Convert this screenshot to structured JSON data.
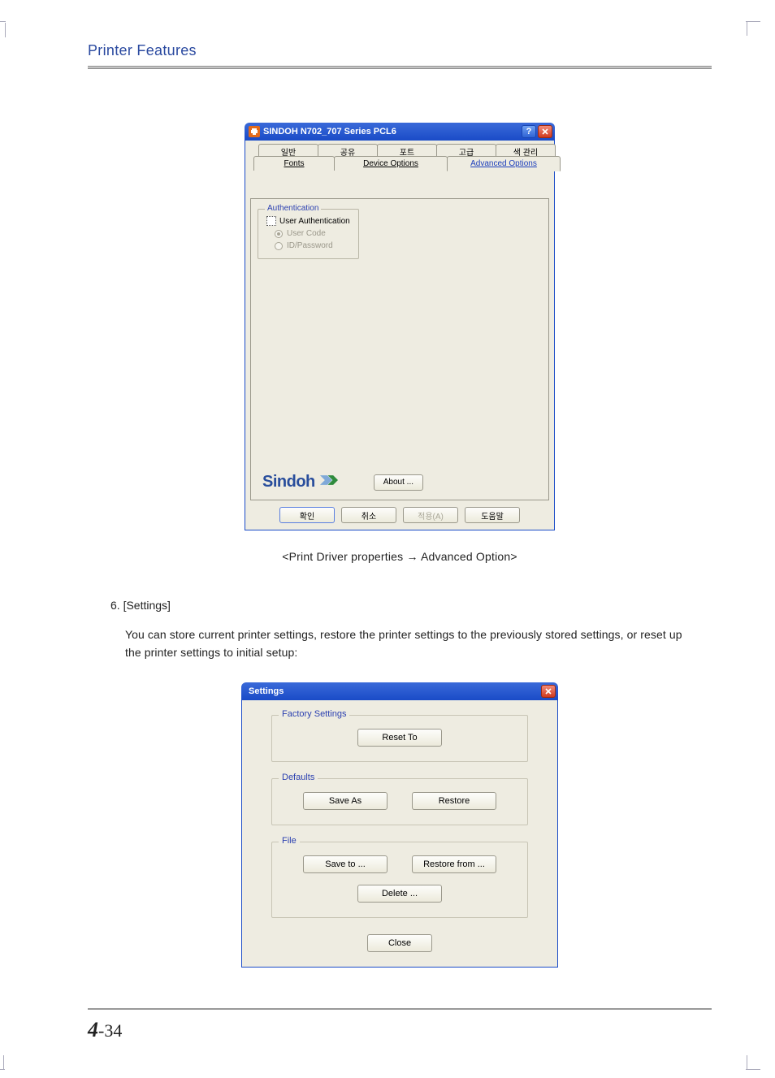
{
  "header_title": "Printer Features",
  "fig1": {
    "titlebar": "SINDOH N702_707 Series PCL6",
    "tabs_top": [
      "일반",
      "공유",
      "포트",
      "고급",
      "색 관리"
    ],
    "tabs_bot": [
      "Fonts",
      "Device Options",
      "Advanced Options"
    ],
    "auth": {
      "legend": "Authentication",
      "checkbox_label": "User Authentication",
      "radio_user_code": "User Code",
      "radio_id_password": "ID/Password"
    },
    "logo_text": "Sindoh",
    "about_btn": "About ...",
    "dlg_buttons": {
      "ok": "확인",
      "cancel": "취소",
      "apply": "적용(A)",
      "help": "도움말"
    }
  },
  "caption": "<Print Driver properties  → Advanced Option>",
  "step": {
    "heading": "6. [Settings]",
    "body": "You can store current printer settings, restore the printer settings to the previously stored settings, or reset up the printer settings to initial setup:"
  },
  "fig2": {
    "titlebar": "Settings",
    "factory": {
      "legend": "Factory Settings",
      "reset": "Reset To"
    },
    "defaults": {
      "legend": "Defaults",
      "save_as": "Save As",
      "restore": "Restore"
    },
    "file": {
      "legend": "File",
      "save_to": "Save to ...",
      "restore_from": "Restore from ...",
      "delete": "Delete ..."
    },
    "close": "Close"
  },
  "page_number": {
    "chapter": "4",
    "sep": "-",
    "page": "34"
  }
}
